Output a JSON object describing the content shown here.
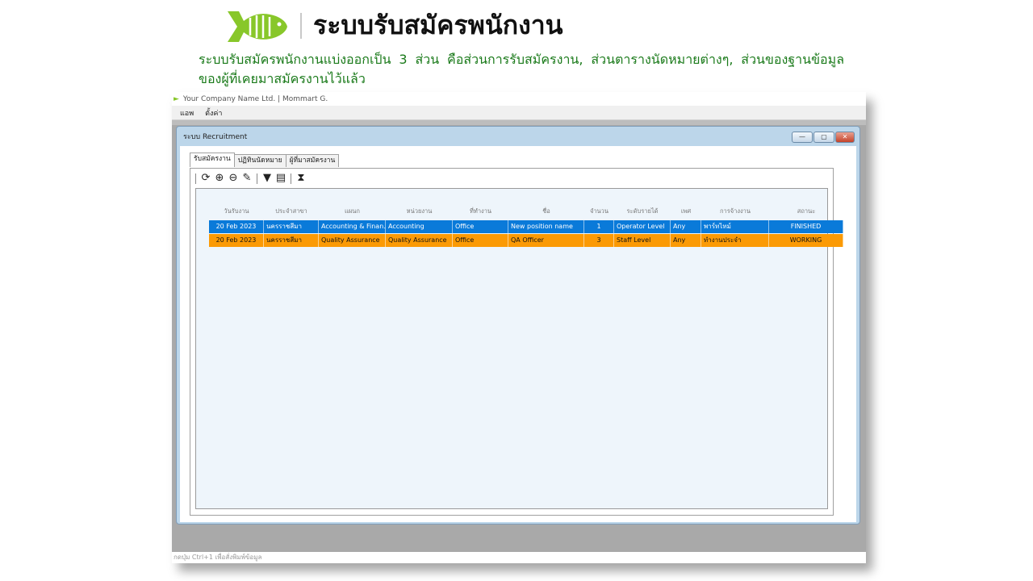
{
  "slide": {
    "title": "ระบบรับสมัครพนักงาน",
    "description": "ระบบรับสมัครพนักงานแบ่งออกเป็น 3 ส่วน คือส่วนการรับสมัครงาน, ส่วนตารางนัดหมายต่างๆ, ส่วนของฐานข้อมูลของผู้ที่เคยมาสมัครงานไว้แล้ว",
    "logo_icon": "fish-logo-icon",
    "accent_color": "#88c72a",
    "text_color": "#1a7a1a"
  },
  "app": {
    "title": "Your Company Name Ltd. | Mommart G.",
    "menu": [
      "แอพ",
      "ตั้งค่า"
    ],
    "status": "กดปุ่ม Ctrl+1 เพื่อสั่งพิมพ์ข้อมูล"
  },
  "child_window": {
    "title": "ระบบ Recruitment",
    "buttons": {
      "minimize": "—",
      "maximize": "▢",
      "close": "✕"
    }
  },
  "tabs": [
    {
      "label": "รับสมัครงาน",
      "active": true
    },
    {
      "label": "ปฏิทินนัดหมาย",
      "active": false
    },
    {
      "label": "ผู้ที่มาสมัครงาน",
      "active": false
    }
  ],
  "toolbar": [
    "refresh-icon",
    "add-icon",
    "remove-icon",
    "edit-icon",
    "filter-icon",
    "excel-export-icon",
    "hourglass-icon"
  ],
  "table": {
    "columns": [
      "วันรับงาน",
      "ประจำสาขา",
      "แผนก",
      "หน่วยงาน",
      "ที่ทำงาน",
      "ชื่อ",
      "จำนวน",
      "ระดับรายได้",
      "เพศ",
      "การจ้างงาน",
      "สถานะ"
    ],
    "rows": [
      {
        "color": "#0a7ad9",
        "cells": [
          "20 Feb 2023",
          "นครราชสีมา",
          "Accounting & Finan...",
          "Accounting",
          "Office",
          "New position name",
          "1",
          "Operator Level",
          "Any",
          "พาร์ทไทม์",
          "FINISHED"
        ]
      },
      {
        "color": "#fb9a05",
        "cells": [
          "20 Feb 2023",
          "นครราชสีมา",
          "Quality Assurance",
          "Quality Assurance",
          "Office",
          "QA Officer",
          "3",
          "Staff Level",
          "Any",
          "ทำงานประจำ",
          "WORKING"
        ]
      }
    ]
  }
}
